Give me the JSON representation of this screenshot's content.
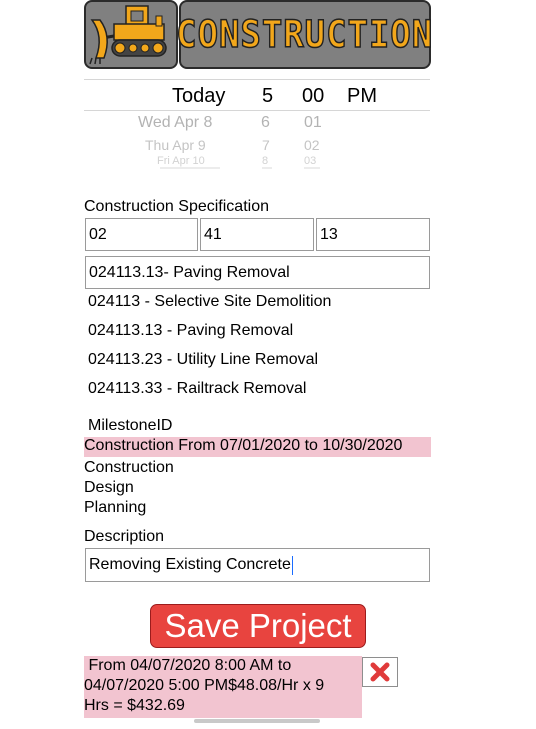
{
  "header": {
    "title": "CONSTRUCTION",
    "logo_icon": "bulldozer-icon"
  },
  "picker": {
    "selected": {
      "day": "Today",
      "hour": "5",
      "minute": "00",
      "ampm": "PM"
    },
    "rows": [
      {
        "day": "Wed Apr 8",
        "hour": "6",
        "minute": "01"
      },
      {
        "day": "Thu Apr 9",
        "hour": "7",
        "minute": "02"
      },
      {
        "day": "Fri Apr 10",
        "hour": "8",
        "minute": "03"
      }
    ]
  },
  "spec": {
    "label": "Construction Specification",
    "field1": "02",
    "field2": "41",
    "field3": "13",
    "selected": "024113.13- Paving Removal",
    "options": [
      "024113 - Selective Site Demolition",
      "024113.13 -  Paving Removal",
      "024113.23 -  Utility Line Removal",
      "024113.33 -  Railtrack Removal"
    ]
  },
  "milestone": {
    "label": "MilestoneID",
    "selected": "Construction From 07/01/2020 to 10/30/2020",
    "options": [
      "Construction",
      "Design",
      "Planning"
    ]
  },
  "description": {
    "label": "Description",
    "value": "Removing Existing Concrete"
  },
  "save_label": "Save Project",
  "result": {
    "line1": " From 04/07/2020 8:00 AM to",
    "line2": "04/07/2020 5:00 PM$48.08/Hr x 9",
    "line3": "Hrs = $432.69"
  },
  "colors": {
    "accent_red": "#e8443f",
    "highlight_pink": "#f2c4d0",
    "header_gray": "#808080",
    "title_orange": "#f2a71b"
  }
}
